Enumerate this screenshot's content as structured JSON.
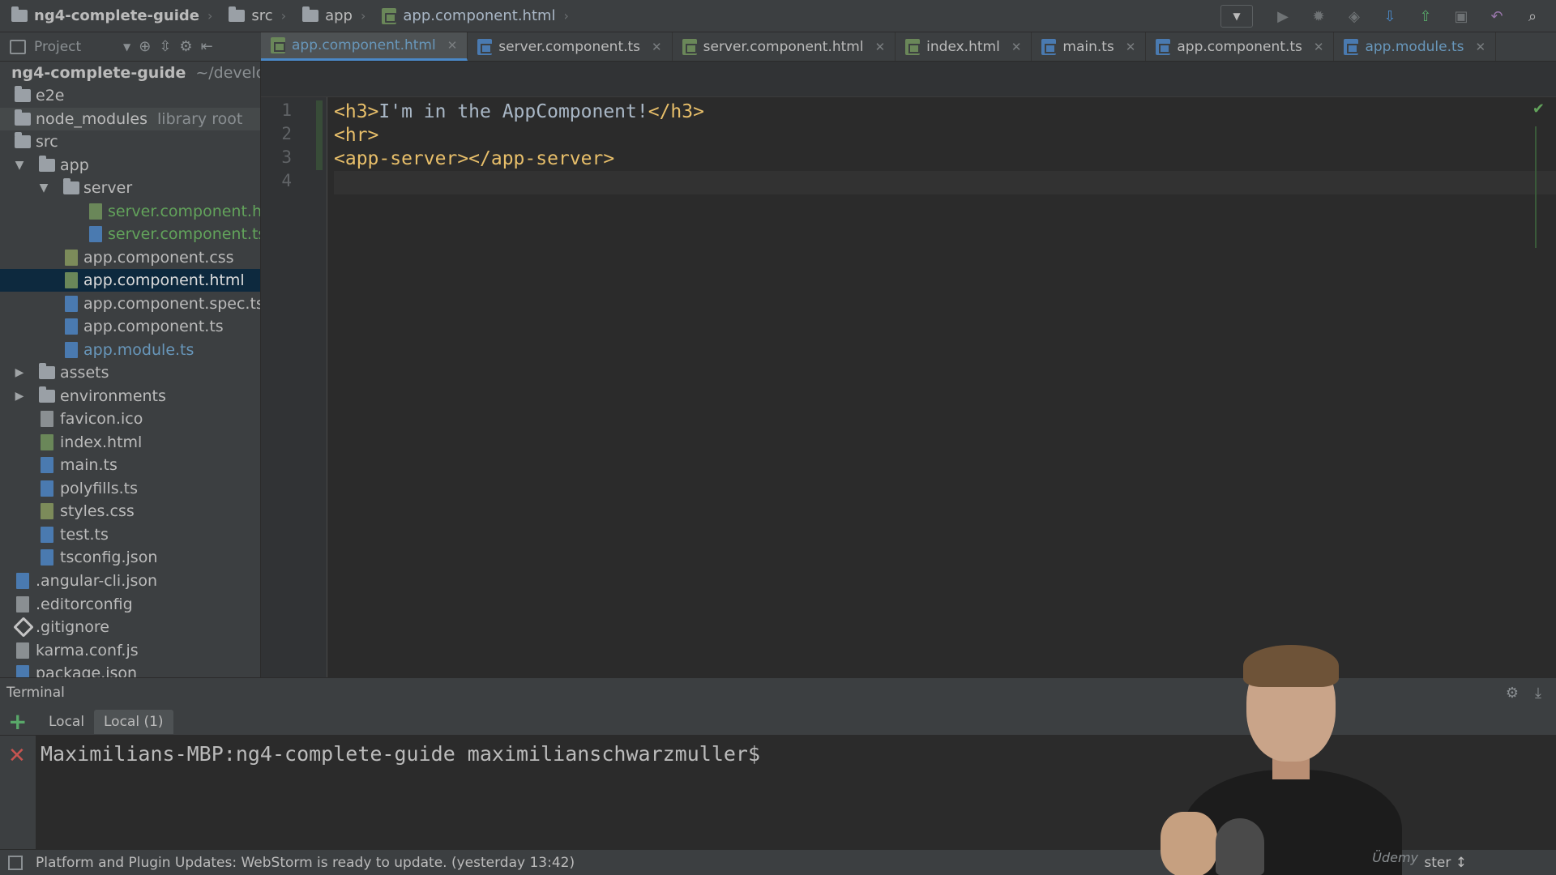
{
  "breadcrumb": {
    "project": "ng4-complete-guide",
    "src": "src",
    "app": "app",
    "file": "app.component.html"
  },
  "project_panel": {
    "label": "Project"
  },
  "tabs": [
    {
      "label": "app.component.html",
      "type": "html",
      "active": true
    },
    {
      "label": "server.component.ts",
      "type": "ts",
      "active": false
    },
    {
      "label": "server.component.html",
      "type": "html",
      "active": false
    },
    {
      "label": "index.html",
      "type": "html",
      "active": false
    },
    {
      "label": "main.ts",
      "type": "ts",
      "active": false
    },
    {
      "label": "app.component.ts",
      "type": "ts",
      "active": false
    },
    {
      "label": "app.module.ts",
      "type": "ts",
      "active": false
    }
  ],
  "tree": {
    "root_name": "ng4-complete-guide",
    "root_path": "~/developm",
    "e2e": "e2e",
    "node_modules": "node_modules",
    "node_modules_note": "library root",
    "src": "src",
    "app": "app",
    "server": "server",
    "server_html": "server.component.html",
    "server_ts": "server.component.ts",
    "app_css": "app.component.css",
    "app_html": "app.component.html",
    "app_spec": "app.component.spec.ts",
    "app_ts": "app.component.ts",
    "app_module": "app.module.ts",
    "assets": "assets",
    "environments": "environments",
    "favicon": "favicon.ico",
    "index": "index.html",
    "main": "main.ts",
    "polyfills": "polyfills.ts",
    "styles": "styles.css",
    "test": "test.ts",
    "tsconfig": "tsconfig.json",
    "angular_cli": ".angular-cli.json",
    "editorconfig": ".editorconfig",
    "gitignore": ".gitignore",
    "karma": "karma.conf.js",
    "package": "package.json"
  },
  "editor": {
    "line_numbers": [
      "1",
      "2",
      "3",
      "4"
    ],
    "lines": {
      "l1_open": "<h3>",
      "l1_text": "I'm in the AppComponent!",
      "l1_close": "</h3>",
      "l2": "<hr>",
      "l3": "<app-server></app-server>"
    }
  },
  "terminal": {
    "title": "Terminal",
    "tabs": [
      "Local",
      "Local (1)"
    ],
    "prompt": "Maximilians-MBP:ng4-complete-guide maximilianschwarzmuller$"
  },
  "statusbar": {
    "message": "Platform and Plugin Updates: WebStorm is ready to update. (yesterday 13:42)",
    "branch": "ster ↕"
  },
  "watermark": "Üdemy"
}
